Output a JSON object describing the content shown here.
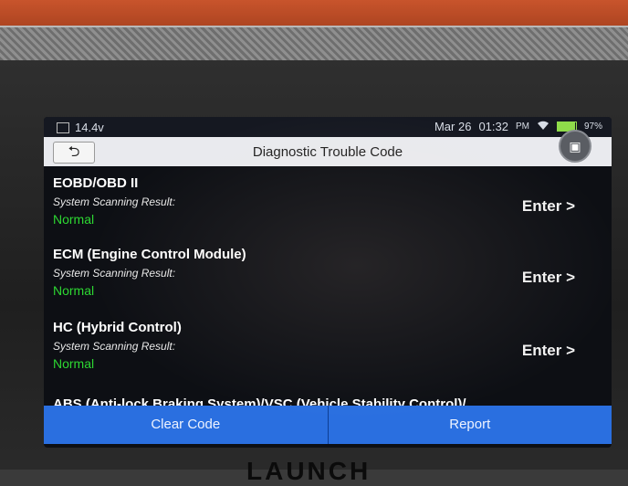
{
  "status_bar": {
    "left_indicator": "14.4v",
    "date": "Mar 26",
    "time": "01:32",
    "ampm": "PM",
    "battery_percent": "97%",
    "battery_level": 0.97,
    "wifi": "wifi-icon"
  },
  "header": {
    "back_icon": "back-arrow-icon",
    "title": "Diagnostic Trouble Code",
    "camera_icon": "camera-icon"
  },
  "items": [
    {
      "title": "EOBD/OBD II",
      "subtitle": "System Scanning Result:",
      "status": "Normal",
      "action": "Enter >"
    },
    {
      "title": "ECM (Engine Control Module)",
      "subtitle": "System Scanning Result:",
      "status": "Normal",
      "action": "Enter >"
    },
    {
      "title": "HC (Hybrid Control)",
      "subtitle": "System Scanning Result:",
      "status": "Normal",
      "action": "Enter >"
    }
  ],
  "partial_item": "ABS (Anti-lock Braking System)/VSC (Vehicle Stability Control)/",
  "footer": {
    "clear_code": "Clear Code",
    "report": "Report"
  },
  "device": {
    "brand": "LAUNCH"
  },
  "colors": {
    "status_ok": "#2dd832",
    "button_blue": "#2a6fe0"
  }
}
